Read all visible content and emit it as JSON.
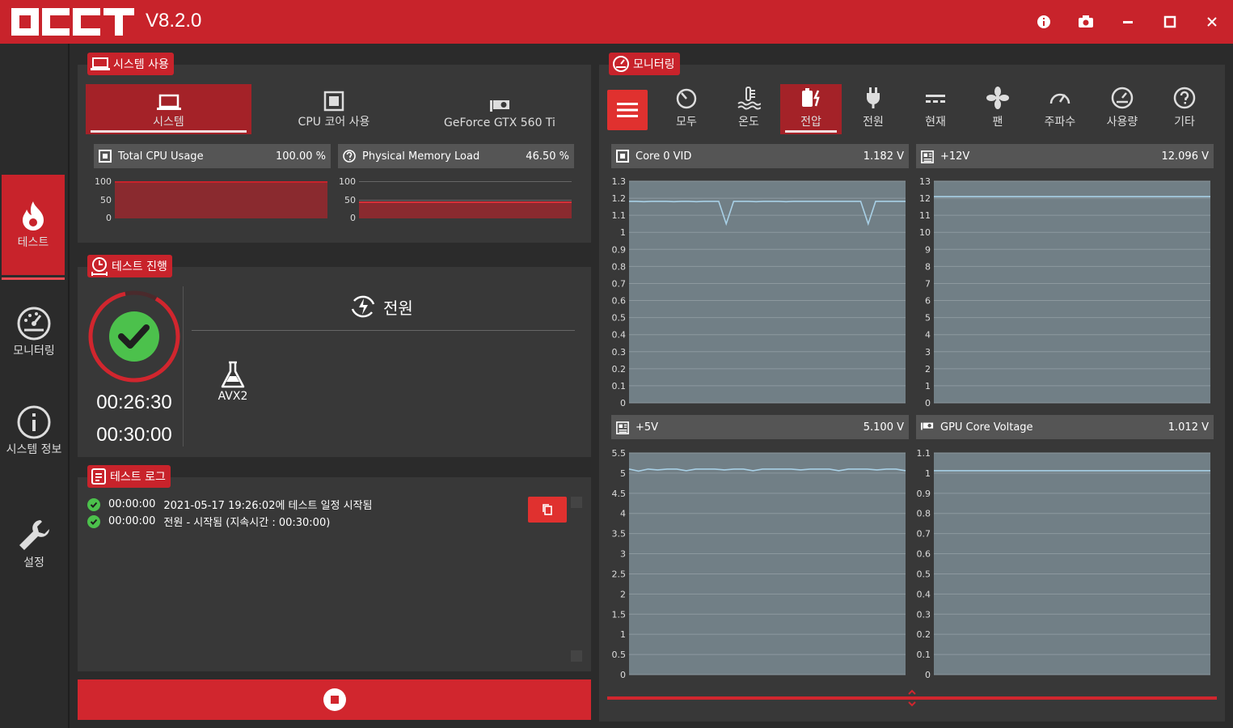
{
  "app": {
    "version": "V8.2.0"
  },
  "nav": [
    {
      "label": "테스트",
      "icon": "flame-icon"
    },
    {
      "label": "모니터링",
      "icon": "gauge-icon"
    },
    {
      "label": "시스템 정보",
      "icon": "info-icon"
    },
    {
      "label": "설정",
      "icon": "wrench-icon"
    }
  ],
  "system_usage": {
    "tag": "시스템 사용",
    "tabs": [
      "시스템",
      "CPU 코어 사용",
      "GeForce GTX 560 Ti"
    ],
    "cpu": {
      "label": "Total CPU Usage",
      "value": "100.00 %",
      "level": 100
    },
    "mem": {
      "label": "Physical Memory Load",
      "value": "46.50 %",
      "level": 46.5
    },
    "axis": [
      "100",
      "50",
      "0"
    ]
  },
  "test_progress": {
    "tag": "테스트 진행",
    "elapsed": "00:26:30",
    "total": "00:30:00",
    "test_name": "전원",
    "mode": "AVX2",
    "progress_fraction": 0.883
  },
  "test_log": {
    "tag": "테스트 로그",
    "entries": [
      {
        "time": "00:00:00",
        "text": "2021-05-17 19:26:02에 테스트 일정 시작됨"
      },
      {
        "time": "00:00:00",
        "text": "전원 - 시작됨 (지속시간 : 00:30:00)"
      }
    ]
  },
  "monitoring": {
    "tag": "모니터링",
    "tabs": [
      "모두",
      "온도",
      "전압",
      "전원",
      "현재",
      "팬",
      "주파수",
      "사용량",
      "기타"
    ],
    "active_tab": "전압"
  },
  "colors": {
    "accent": "#c8232b",
    "chart_bg": "#717f86",
    "chart_line": "#a8d0e6",
    "ok": "#4cc14c"
  },
  "chart_data": [
    {
      "type": "line",
      "title": "Core 0 VID",
      "current": "1.182 V",
      "yticks": [
        "1.3",
        "1.2",
        "1.1",
        "1",
        "0.9",
        "0.8",
        "0.7",
        "0.6",
        "0.5",
        "0.4",
        "0.3",
        "0.2",
        "0.1",
        "0"
      ],
      "ylim": [
        0,
        1.3
      ],
      "values": [
        1.182,
        1.182,
        1.18,
        1.182,
        1.182,
        1.182,
        1.18,
        1.182,
        1.182,
        1.18,
        1.182,
        1.182,
        1.182,
        1.05,
        1.182,
        1.182,
        1.182,
        1.18,
        1.182,
        1.182,
        1.182,
        1.18,
        1.182,
        1.182,
        1.182,
        1.182,
        1.182,
        1.182,
        1.182,
        1.182,
        1.182,
        1.182,
        1.05,
        1.182,
        1.182,
        1.182,
        1.182,
        1.182
      ]
    },
    {
      "type": "line",
      "title": "+12V",
      "current": "12.096 V",
      "yticks": [
        "13",
        "12",
        "11",
        "10",
        "9",
        "8",
        "7",
        "6",
        "5",
        "4",
        "3",
        "2",
        "1",
        "0"
      ],
      "ylim": [
        0,
        13
      ],
      "values": [
        12.096,
        12.096,
        12.096,
        12.096,
        12.096,
        12.096,
        12.096,
        12.096,
        12.096,
        12.096,
        12.096,
        12.096
      ]
    },
    {
      "type": "line",
      "title": "+5V",
      "current": "5.100 V",
      "yticks": [
        "5.5",
        "5",
        "4.5",
        "4",
        "3.5",
        "3",
        "2.5",
        "2",
        "1.5",
        "1",
        "0.5",
        "0"
      ],
      "ylim": [
        0,
        5.5
      ],
      "values": [
        5.1,
        5.05,
        5.1,
        5.08,
        5.1,
        5.1,
        5.06,
        5.1,
        5.1,
        5.1,
        5.08,
        5.1,
        5.1,
        5.06,
        5.1,
        5.1,
        5.1,
        5.1,
        5.08,
        5.1,
        5.1,
        5.1,
        5.06,
        5.1,
        5.1,
        5.1,
        5.08,
        5.1,
        5.1,
        5.06
      ]
    },
    {
      "type": "line",
      "title": "GPU Core Voltage",
      "current": "1.012 V",
      "yticks": [
        "1.1",
        "1",
        "0.9",
        "0.8",
        "0.7",
        "0.6",
        "0.5",
        "0.4",
        "0.3",
        "0.2",
        "0.1",
        "0"
      ],
      "ylim": [
        0,
        1.1
      ],
      "values": [
        1.012,
        1.012,
        1.012,
        1.012,
        1.012,
        1.012,
        1.012,
        1.012,
        1.012,
        1.012
      ]
    }
  ]
}
